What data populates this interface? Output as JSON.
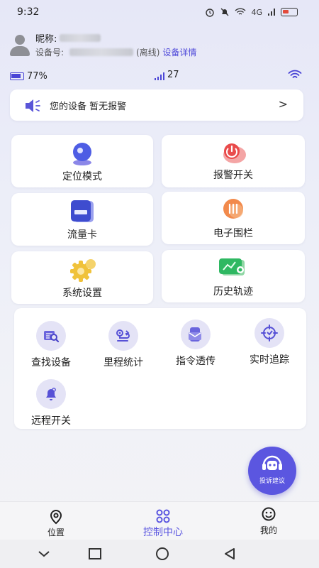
{
  "status_bar": {
    "time": "9:32",
    "network": "4G"
  },
  "profile": {
    "nickname_label": "昵称:",
    "device_no_label": "设备号:",
    "offline_label": "(离线)",
    "device_detail_link": "设备详情"
  },
  "device_info": {
    "battery_percent": "77%",
    "signal_value": "27"
  },
  "alarm_bar": {
    "message": "您的设备 暂无报警",
    "chevron": ">"
  },
  "feature_tiles": [
    {
      "label": "定位模式",
      "icon": "location-pin-icon"
    },
    {
      "label": "报警开关",
      "icon": "alarm-power-icon"
    },
    {
      "label": "流量卡",
      "icon": "sim-card-icon"
    },
    {
      "label": "电子围栏",
      "icon": "fence-icon"
    },
    {
      "label": "系统设置",
      "icon": "gear-icon"
    },
    {
      "label": "历史轨迹",
      "icon": "track-history-icon"
    }
  ],
  "tools": [
    {
      "label": "查找设备",
      "icon": "search-device-icon"
    },
    {
      "label": "里程统计",
      "icon": "mileage-icon"
    },
    {
      "label": "指令透传",
      "icon": "command-icon"
    },
    {
      "label": "实时追踪",
      "icon": "target-icon"
    },
    {
      "label": "远程开关",
      "icon": "bell-icon"
    }
  ],
  "fab": {
    "label": "投诉建议"
  },
  "tabbar": [
    {
      "label": "位置",
      "icon": "location-icon"
    },
    {
      "label": "控制中心",
      "icon": "grid-icon"
    },
    {
      "label": "我的",
      "icon": "smile-icon"
    }
  ],
  "colors": {
    "accent": "#4f49d9",
    "tab_active": "#5b56e0"
  }
}
